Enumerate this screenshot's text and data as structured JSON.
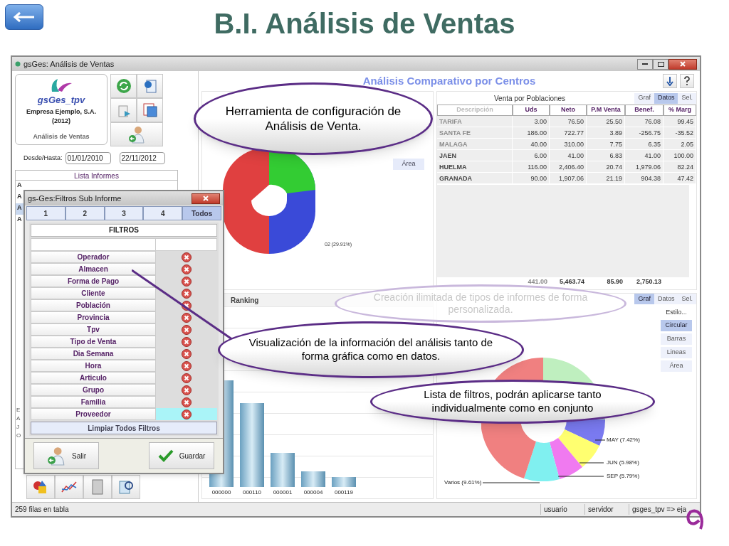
{
  "slide": {
    "title": "B.I. Análisis de Ventas"
  },
  "window": {
    "title": "gsGes: Análisis de Ventas"
  },
  "company": {
    "app_name": "gsGes_tpv",
    "name": "Empresa Ejemplo, S.A.",
    "year": "(2012)",
    "module": "Análisis de Ventas"
  },
  "date_range": {
    "label": "Desde/Hasta:",
    "from": "01/01/2010",
    "to": "22/11/2012"
  },
  "report_list": {
    "header": "Lista Informes",
    "rows": [
      {
        "label": "A",
        "selected": false
      },
      {
        "label": "A",
        "selected": false
      },
      {
        "label": "A",
        "selected": true
      },
      {
        "label": "A",
        "selected": false
      }
    ],
    "lower_rows": [
      "E",
      "A",
      "J",
      "O"
    ]
  },
  "main_title": "Análisis Comparativo por Centros",
  "centers_panel": {
    "style_buttons": [
      "Área"
    ],
    "pie_labels": [
      "02 (29.91%)"
    ]
  },
  "towns_panel": {
    "title": "Venta por Poblaciones",
    "view_tabs": [
      {
        "label": "Graf",
        "selected": false
      },
      {
        "label": "Datos",
        "selected": true
      },
      {
        "label": "Sel.",
        "selected": false
      }
    ],
    "columns": [
      "Descripción",
      "Uds",
      "Neto",
      "P.M Venta",
      "Benef.",
      "% Marg"
    ],
    "rows": [
      [
        "TARIFA",
        "3.00",
        "76.50",
        "25.50",
        "76.08",
        "99.45"
      ],
      [
        "SANTA FE",
        "186.00",
        "722.77",
        "3.89",
        "-256.75",
        "-35.52"
      ],
      [
        "MALAGA",
        "40.00",
        "310.00",
        "7.75",
        "6.35",
        "2.05"
      ],
      [
        "JAEN",
        "6.00",
        "41.00",
        "6.83",
        "41.00",
        "100.00"
      ],
      [
        "HUELMA",
        "116.00",
        "2,406.40",
        "20.74",
        "1,979.06",
        "82.24"
      ],
      [
        "GRANADA",
        "90.00",
        "1,907.06",
        "21.19",
        "904.38",
        "47.42"
      ]
    ],
    "totals": [
      "441.00",
      "5,463.74",
      "85.90",
      "2,750.13"
    ]
  },
  "ranking_panel": {
    "title": "Ranking",
    "bar_labels": [
      "000000",
      "000110",
      "000001",
      "000004",
      "000119"
    ]
  },
  "months_panel": {
    "view_tabs": [
      {
        "label": "Graf",
        "selected": true
      },
      {
        "label": "Datos",
        "selected": false
      },
      {
        "label": "Sel.",
        "selected": false
      }
    ],
    "style_label": "Estilo...",
    "style_buttons": [
      {
        "label": "Circular",
        "selected": true
      },
      {
        "label": "Barras",
        "selected": false
      },
      {
        "label": "Lineas",
        "selected": false
      },
      {
        "label": "Área",
        "selected": false
      }
    ],
    "pie_labels": [
      "MAY (7.42%)",
      "JUN (5.98%)",
      "SEP (5.79%)",
      "Varios (9.61%)"
    ]
  },
  "status_bar": [
    "259 filas en tabla",
    "usuario",
    "servidor",
    "gsges_tpv => eja"
  ],
  "filter_dialog": {
    "title": "gs-Ges:Filtros Sub Informe",
    "tabs": [
      {
        "label": "1",
        "selected": false
      },
      {
        "label": "2",
        "selected": false
      },
      {
        "label": "3",
        "selected": false
      },
      {
        "label": "4",
        "selected": false
      },
      {
        "label": "Todos",
        "selected": true
      }
    ],
    "header": "FILTROS",
    "filters": [
      {
        "label": "Operador",
        "selected": false
      },
      {
        "label": "Almacen",
        "selected": false
      },
      {
        "label": "Forma de Pago",
        "selected": false
      },
      {
        "label": "Cliente",
        "selected": false
      },
      {
        "label": "Población",
        "selected": false
      },
      {
        "label": "Provincia",
        "selected": false
      },
      {
        "label": "Tpv",
        "selected": false
      },
      {
        "label": "Tipo de Venta",
        "selected": false
      },
      {
        "label": "Dia Semana",
        "selected": false
      },
      {
        "label": "Hora",
        "selected": false
      },
      {
        "label": "Articulo",
        "selected": false
      },
      {
        "label": "Grupo",
        "selected": false
      },
      {
        "label": "Familia",
        "selected": false
      },
      {
        "label": "Proveedor",
        "selected": true
      }
    ],
    "clear_button": "Limpiar Todos Filtros",
    "buttons": [
      {
        "label": "Salir",
        "kind": "exit"
      },
      {
        "label": "Guardar",
        "kind": "save"
      }
    ]
  },
  "callouts": [
    {
      "text": "Herramienta de configuración de Análisis de Venta.",
      "faded": false
    },
    {
      "text": "Creación ilimitada de tipos de informes de forma personalizada.",
      "faded": true
    },
    {
      "text": "Visualización de la información del análisis tanto de forma gráfica como en datos.",
      "faded": false
    },
    {
      "text": "Lista de filtros, podrán aplicarse tanto individualmente como en conjunto",
      "faded": false
    }
  ]
}
